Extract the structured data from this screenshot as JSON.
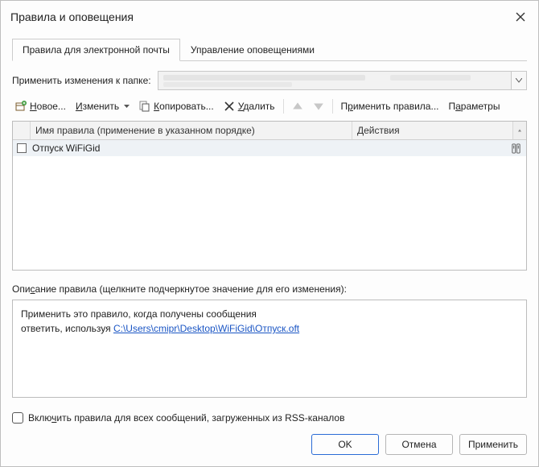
{
  "window": {
    "title": "Правила и оповещения"
  },
  "tabs": {
    "email_rules": "Правила для электронной почты",
    "alerts": "Управление оповещениями"
  },
  "apply_folder": {
    "label": "Применить изменения к папке:",
    "value": ""
  },
  "toolbar": {
    "new": {
      "pre": "",
      "u": "Н",
      "post": "овое..."
    },
    "edit": {
      "pre": "",
      "u": "И",
      "post": "зменить"
    },
    "copy": {
      "pre": "",
      "u": "К",
      "post": "опировать..."
    },
    "delete": {
      "pre": "",
      "u": "У",
      "post": "далить"
    },
    "apply": {
      "pre": "П",
      "u": "р",
      "post": "именить правила..."
    },
    "options": {
      "pre": "П",
      "u": "а",
      "post": "раметры"
    }
  },
  "grid": {
    "col_name": "Имя правила (применение в указанном порядке)",
    "col_actions": "Действия",
    "rows": [
      {
        "checked": false,
        "name": "Отпуск WiFiGid"
      }
    ]
  },
  "description": {
    "label_pre": "Опи",
    "label_u": "с",
    "label_post": "ание правила (щелкните подчеркнутое значение для его изменения):",
    "line1": "Применить это правило, когда получены сообщения",
    "line2_pre": "ответить, используя ",
    "line2_link": "C:\\Users\\cmipr\\Desktop\\WiFiGid\\Отпуск.oft"
  },
  "rss": {
    "label_pre": "Вклю",
    "label_u": "ч",
    "label_post": "ить правила для всех сообщений, загруженных из RSS-каналов",
    "checked": false
  },
  "buttons": {
    "ok": "OK",
    "cancel": "Отмена",
    "apply": "Применить"
  }
}
